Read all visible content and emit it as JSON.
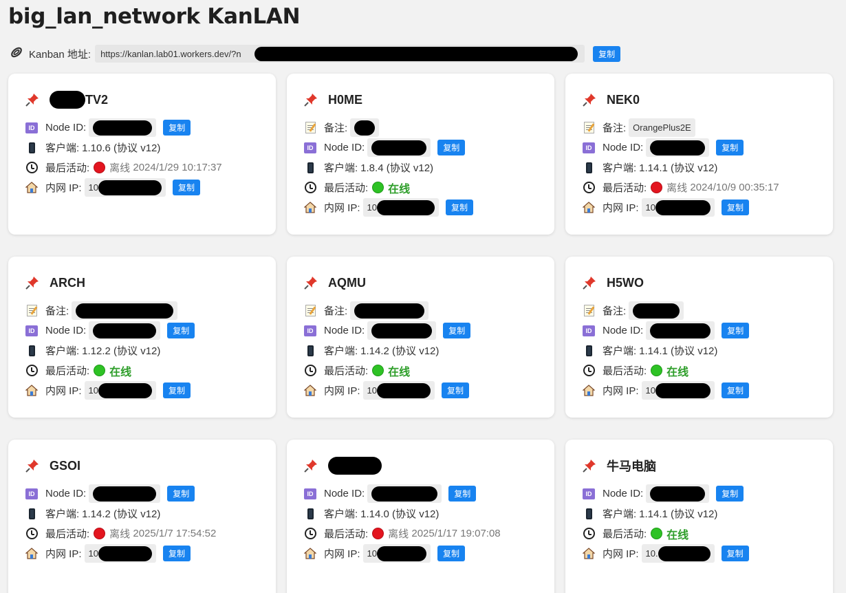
{
  "page": {
    "title": "big_lan_network KanLAN"
  },
  "kanban": {
    "label": "Kanban 地址:",
    "url": "https://kanlan.lab01.workers.dev/?n",
    "copy_label": "复制"
  },
  "labels": {
    "node_id": "Node ID:",
    "note": "备注:",
    "client": "客户端:",
    "last_active": "最后活动:",
    "lan_ip": "内网 IP:",
    "copy": "复制",
    "online": "在线",
    "offline": "离线"
  },
  "colors": {
    "accent": "#1883f0",
    "online": "#2e9e2a",
    "offline_dot": "#e3151f"
  },
  "cards": [
    {
      "name_visible": "TV2",
      "client": "1.10.6 (协议 v12)",
      "status": "offline",
      "last_seen": "2024/1/29 10:17:37",
      "ip_prefix": "10"
    },
    {
      "name": "H0ME",
      "client": "1.8.4 (协议 v12)",
      "status": "online",
      "ip_prefix": "10"
    },
    {
      "name": "NEK0",
      "note": "OrangePlus2E",
      "client": "1.14.1 (协议 v12)",
      "status": "offline",
      "last_seen": "2024/10/9 00:35:17",
      "ip_prefix": "10"
    },
    {
      "name": "ARCH",
      "client": "1.12.2 (协议 v12)",
      "status": "online",
      "ip_prefix": "10"
    },
    {
      "name": "AQMU",
      "client": "1.14.2 (协议 v12)",
      "status": "online",
      "ip_prefix": "10"
    },
    {
      "name": "H5WO",
      "client": "1.14.1 (协议 v12)",
      "status": "online",
      "ip_prefix": "10"
    },
    {
      "name": "GSOI",
      "client": "1.14.2 (协议 v12)",
      "status": "offline",
      "last_seen": "2025/1/7 17:54:52",
      "ip_prefix": "10"
    },
    {
      "client": "1.14.0 (协议 v12)",
      "status": "offline",
      "last_seen": "2025/1/17 19:07:08",
      "ip_prefix": "10"
    },
    {
      "name": "牛马电脑",
      "client": "1.14.1 (协议 v12)",
      "status": "online",
      "ip_prefix": "10."
    }
  ]
}
